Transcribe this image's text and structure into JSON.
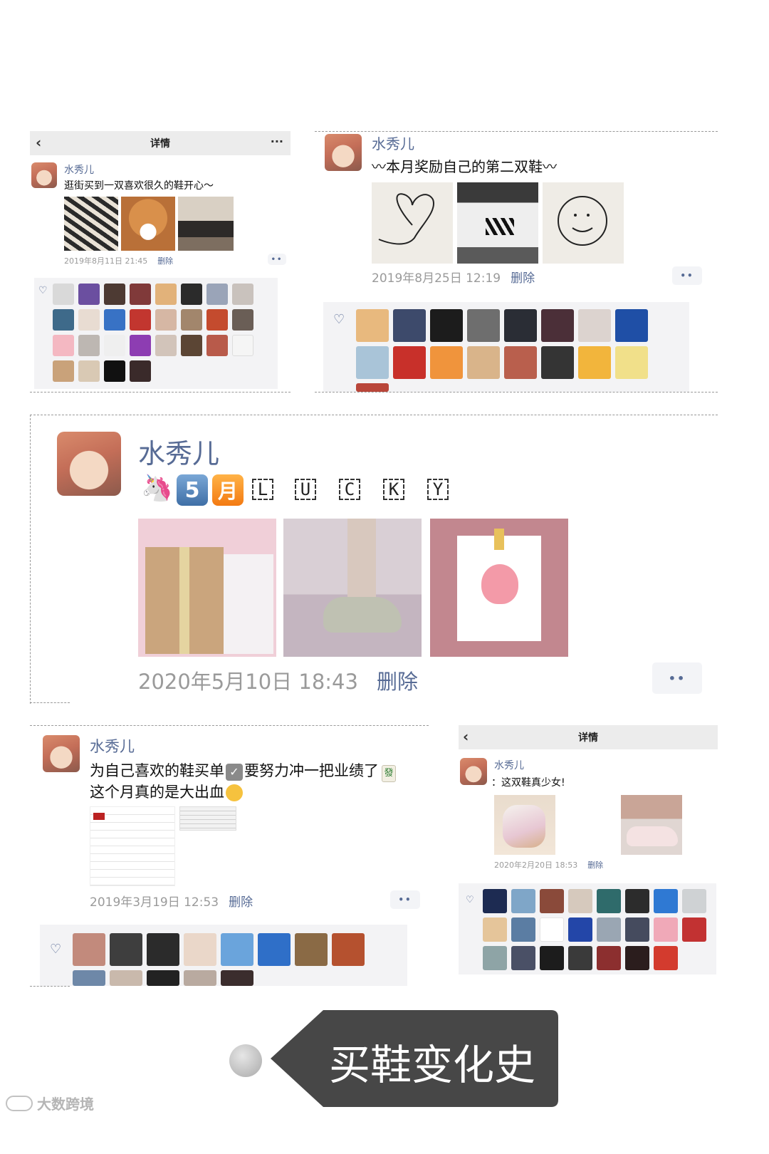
{
  "card1": {
    "header_title": "详情",
    "name": "水秀儿",
    "text": "逛街买到一双喜欢很久的鞋开心～",
    "time": "2019年8月11日 21:45",
    "delete_label": "删除"
  },
  "card2": {
    "name": "水秀儿",
    "text": "〰本月奖励自己的第二双鞋〰",
    "time": "2019年8月25日 12:19",
    "delete_label": "删除"
  },
  "card3": {
    "name": "水秀儿",
    "badge_five": "5",
    "badge_month": "月",
    "letters": [
      "L",
      "U",
      "C",
      "K",
      "Y"
    ],
    "time": "2020年5月10日 18:43",
    "delete_label": "删除"
  },
  "card4": {
    "name": "水秀儿",
    "text_line1": "为自己喜欢的鞋买单",
    "text_line1b": "要努力冲一把业绩了",
    "text_line2": "这个月真的是大出血",
    "time": "2019年3月19日 12:53",
    "delete_label": "删除"
  },
  "card5": {
    "header_title": "详情",
    "name": "水秀儿",
    "text": "：这双鞋真少女!",
    "time": "2020年2月20日 18:53",
    "delete_label": "删除"
  },
  "banner": {
    "title": "买鞋变化史"
  },
  "watermark": {
    "text": "大数跨境"
  },
  "icons": {
    "back": "chevron-left-icon",
    "more": "ellipsis-icon",
    "heart": "heart-icon",
    "action": "comment-dots-icon"
  },
  "colors": {
    "link": "#576b95",
    "meta": "#9a9a9a",
    "banner": "#474747"
  }
}
